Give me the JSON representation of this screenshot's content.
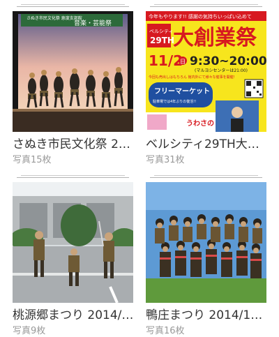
{
  "albums": [
    {
      "title": "さぬき市民文化祭 2…",
      "count": "写真15枚",
      "banner_text": "音楽・芸能祭",
      "banner_sub": "さぬき市民文化祭 恵度支部館"
    },
    {
      "title": "ベルシティ29TH大…",
      "count": "写真31枚",
      "poster": {
        "headline": "今年もやります!! 感謝の気持ちいっぱい込めて",
        "brand": "ベルシティ 29TH",
        "big": "大創業祭",
        "date": "11/2",
        "weekday": "日",
        "time": "9:30~20:00",
        "note": "(マルヨシセンターは21:00)",
        "line2": "今回も売出しはもちろん 館内外にて様々な催事を開催!",
        "market": "フリーマーケット",
        "market_sub": "駐車場では4年ぶりの復活!!",
        "bottom": "うわさの"
      }
    },
    {
      "title": "桃源郷まつり 2014/…",
      "count": "写真9枚"
    },
    {
      "title": "鴨庄まつり 2014/1…",
      "count": "写真16枚"
    }
  ],
  "colors": {
    "title_text": "#333333",
    "count_text": "#999999",
    "poster_yellow": "#f7e51d",
    "poster_red": "#d71920",
    "poster_blue": "#1f4fa0"
  }
}
